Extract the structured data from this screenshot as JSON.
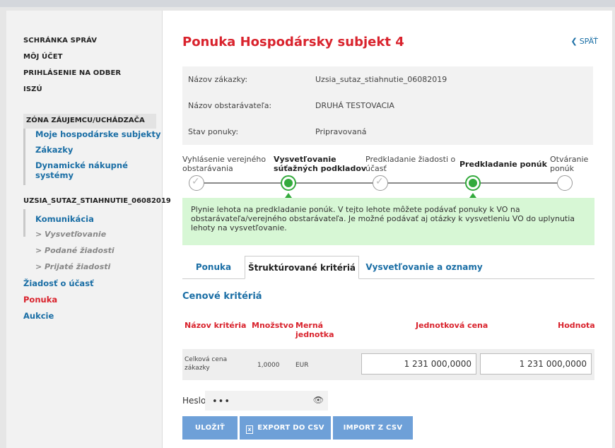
{
  "sidebar": {
    "top_links": [
      "SCHRÁNKA SPRÁV",
      "MÔJ ÚČET",
      "PRIHLÁSENIE NA ODBER",
      "ISZÚ"
    ],
    "zone_header": "ZÓNA ZÁUJEMCU/UCHÁDZAČA",
    "zone_items": [
      "Moje hospodárske subjekty",
      "Zákazky",
      "Dynamické nákupné systémy"
    ],
    "contract_header": "UZSIA_SUTAZ_STIAHNUTIE_06082019",
    "contract_items": {
      "komunikacia": "Komunikácia",
      "vysvetlovanie": "> Vysvetľovanie",
      "podane": "> Podané žiadosti",
      "prijate": "> Prijaté žiadosti",
      "ziadost": "Žiadosť o účasť",
      "ponuka": "Ponuka",
      "aukcie": "Aukcie"
    }
  },
  "page": {
    "title": "Ponuka Hospodársky subjekt 4",
    "back_label": "SPÄŤ"
  },
  "info": [
    {
      "label": "Názov zákazky:",
      "value": "Uzsia_sutaz_stiahnutie_06082019"
    },
    {
      "label": "Názov obstarávateľa:",
      "value": "DRUHÁ TESTOVACIA"
    },
    {
      "label": "Stav ponuky:",
      "value": "Pripravovaná"
    }
  ],
  "steps": [
    {
      "line1": "Vyhlásenie verejného",
      "line2": "obstarávania",
      "state": "done"
    },
    {
      "line1": "Vysvetľovanie",
      "line2": "súťažných podkladov",
      "state": "active"
    },
    {
      "line1": "Predkladanie žiadosti o",
      "line2": "účasť",
      "state": "done"
    },
    {
      "line1": "Predkladanie ponúk",
      "line2": "",
      "state": "active"
    },
    {
      "line1": "Otváranie",
      "line2": "ponúk",
      "state": "pending"
    }
  ],
  "notice": "Plynie lehota na predkladanie ponúk. V tejto lehote môžete podávať ponuky k VO na obstarávateľa/verejného obstarávateľa. Je možné podávať aj otázky k vysvetleniu VO do uplynutia lehoty na vysvetľovanie.",
  "tabs": [
    "Ponuka",
    "Štruktúrované kritériá",
    "Vysvetľovanie a oznamy"
  ],
  "section_title": "Cenové kritériá",
  "table": {
    "headers": {
      "name": "Názov kritéria",
      "qty": "Množstvo",
      "unit_line1": "Merná",
      "unit_line2": "jednotka",
      "unit_price": "Jednotková cena",
      "value": "Hodnota"
    },
    "row": {
      "name_line1": "Celková cena",
      "name_line2": "zákazky",
      "qty": "1,0000",
      "unit": "EUR",
      "unit_price": "1 231 000,0000",
      "value": "1 231 000,0000"
    }
  },
  "password": {
    "label": "Heslo",
    "masked": "•••"
  },
  "buttons": {
    "save": "ULOŽIŤ",
    "export": "EXPORT DO CSV",
    "import": "IMPORT Z CSV"
  },
  "colors": {
    "accent_red": "#d9232d",
    "link_blue": "#1a6ea5",
    "success_green": "#33aa3c",
    "notice_bg": "#d7f7d5",
    "button_blue": "#6ea0d8"
  }
}
